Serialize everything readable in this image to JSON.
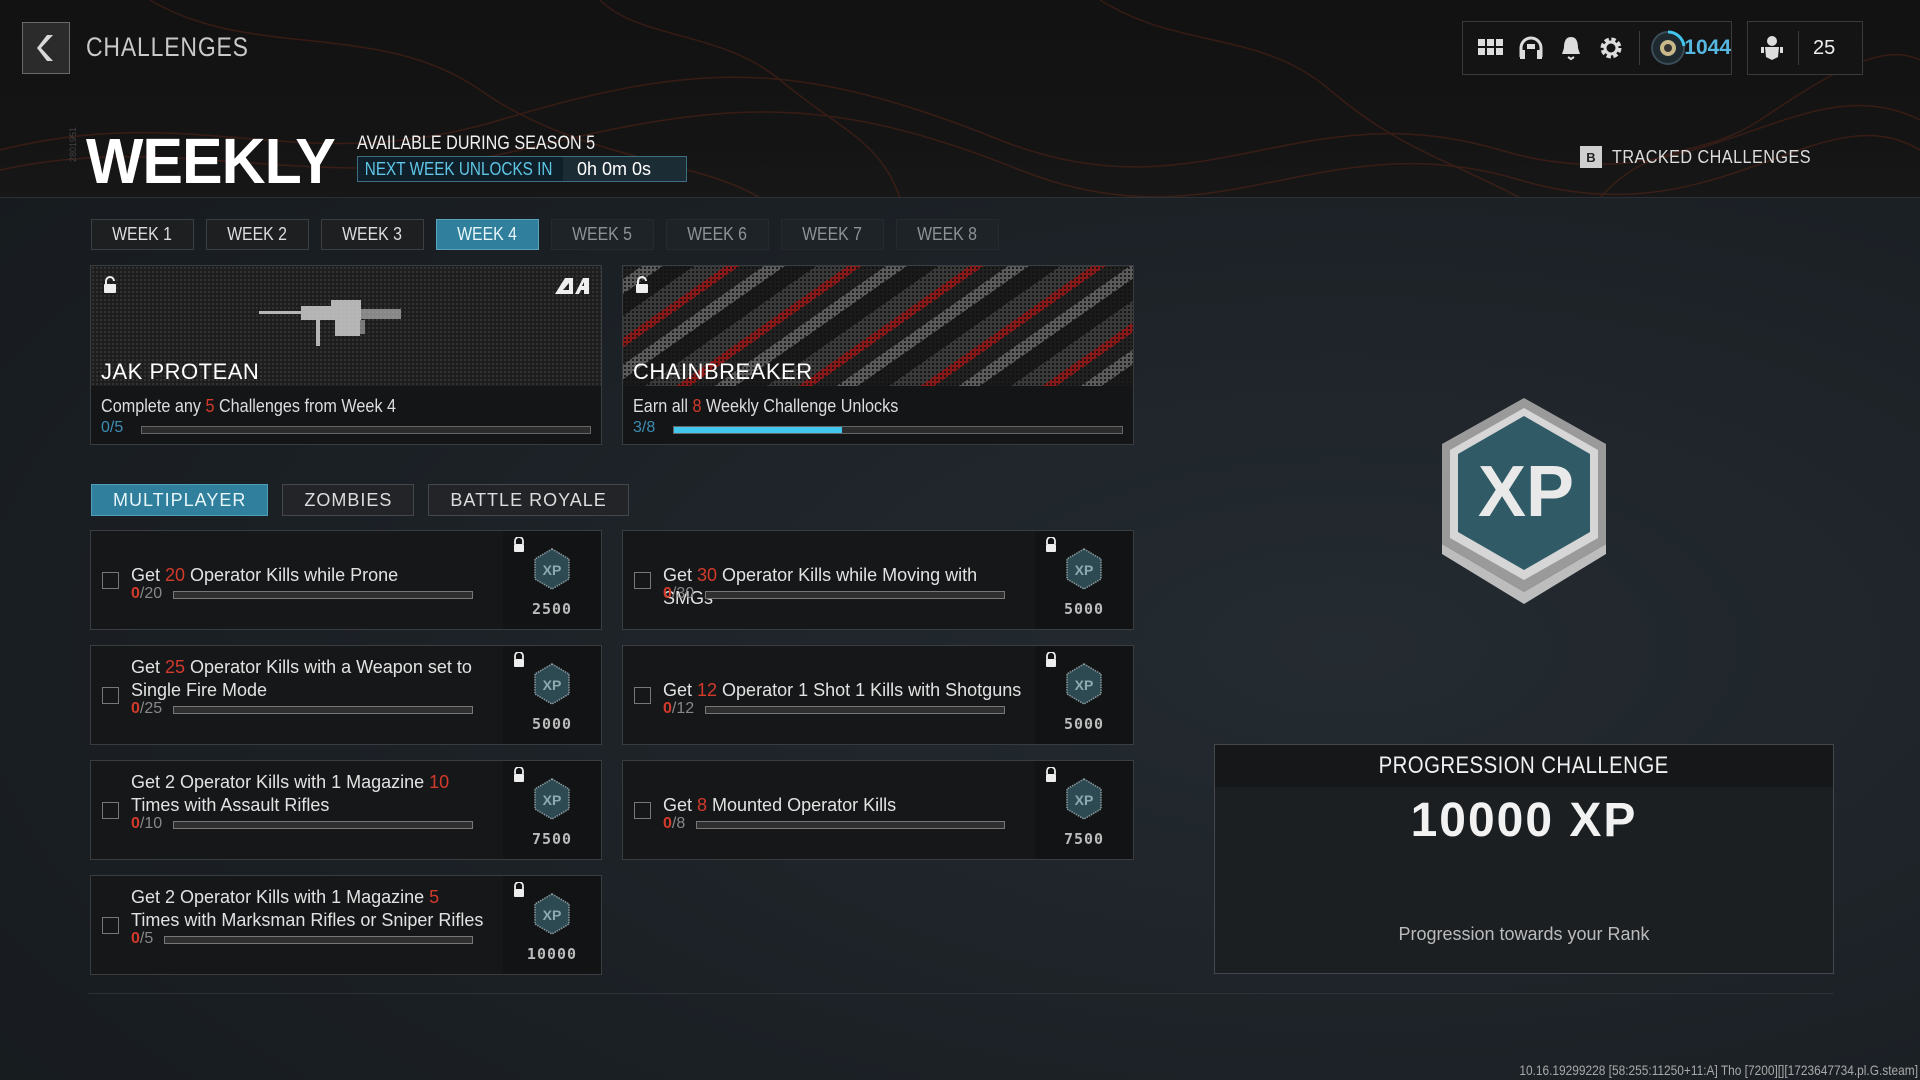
{
  "header": {
    "breadcrumb": "CHALLENGES",
    "title": "WEEKLY",
    "vertical_tag": "2801951",
    "availability": "AVAILABLE DURING SEASON 5",
    "unlock_label": "NEXT WEEK UNLOCKS IN",
    "unlock_timer": "0h 0m 0s",
    "tracked_key": "B",
    "tracked_label": "TRACKED CHALLENGES"
  },
  "hud": {
    "icons": [
      "menu-grid-icon",
      "headset-icon",
      "bell-icon",
      "gear-icon"
    ],
    "rank_value": "1044",
    "party_count": "25"
  },
  "weeks": [
    {
      "label": "WEEK 1",
      "state": "unlocked"
    },
    {
      "label": "WEEK 2",
      "state": "unlocked"
    },
    {
      "label": "WEEK 3",
      "state": "unlocked"
    },
    {
      "label": "WEEK 4",
      "state": "active"
    },
    {
      "label": "WEEK 5",
      "state": "locked"
    },
    {
      "label": "WEEK 6",
      "state": "locked"
    },
    {
      "label": "WEEK 7",
      "state": "locked"
    },
    {
      "label": "WEEK 8",
      "state": "locked"
    }
  ],
  "rewards": [
    {
      "title": "JAK PROTEAN",
      "desc_pre": "Complete any ",
      "desc_num": "5",
      "desc_post": " Challenges from Week 4",
      "progress_text": "0/5",
      "progress": 0.0
    },
    {
      "title": "CHAINBREAKER",
      "desc_pre": "Earn all ",
      "desc_num": "8",
      "desc_post": " Weekly Challenge Unlocks",
      "progress_text": "3/8",
      "progress": 0.375
    }
  ],
  "modes": [
    {
      "label": "MULTIPLAYER",
      "active": true
    },
    {
      "label": "ZOMBIES",
      "active": false
    },
    {
      "label": "BATTLE ROYALE",
      "active": false
    }
  ],
  "challenges": [
    {
      "pre": "Get ",
      "num": "20",
      "post": " Operator Kills while Prone",
      "cur": "0",
      "total": "/20",
      "xp": "2500"
    },
    {
      "pre": "Get ",
      "num": "30",
      "post": " Operator Kills while Moving with SMGs",
      "cur": "0",
      "total": "/30",
      "xp": "5000"
    },
    {
      "pre": "Get ",
      "num": "25",
      "post": " Operator Kills with a Weapon set to Single Fire Mode",
      "cur": "0",
      "total": "/25",
      "xp": "5000"
    },
    {
      "pre": "Get ",
      "num": "12",
      "post": " Operator 1 Shot 1 Kills with Shotguns",
      "cur": "0",
      "total": "/12",
      "xp": "5000"
    },
    {
      "pre": "Get 2 Operator Kills with 1 Magazine ",
      "num": "10",
      "post": " Times with Assault Rifles",
      "cur": "0",
      "total": "/10",
      "xp": "7500"
    },
    {
      "pre": "Get ",
      "num": "8",
      "post": " Mounted Operator Kills",
      "cur": "0",
      "total": "/8",
      "xp": "7500"
    },
    {
      "pre": "Get 2 Operator Kills with 1 Magazine ",
      "num": "5",
      "post": " Times with Marksman Rifles or Sniper Rifles",
      "cur": "0",
      "total": "/5",
      "xp": "10000"
    }
  ],
  "progression": {
    "header": "PROGRESSION CHALLENGE",
    "amount": "10000 XP",
    "subtitle": "Progression towards your Rank",
    "badge_text": "XP"
  },
  "footer": {
    "build": "10.16.19299228 [58:255:11250+11:A] Tho [7200][][1723647734.pl.G.steam]"
  },
  "colors": {
    "accent": "#2f7f9d",
    "highlight": "#d23a2b",
    "progress": "#41c7ee"
  }
}
